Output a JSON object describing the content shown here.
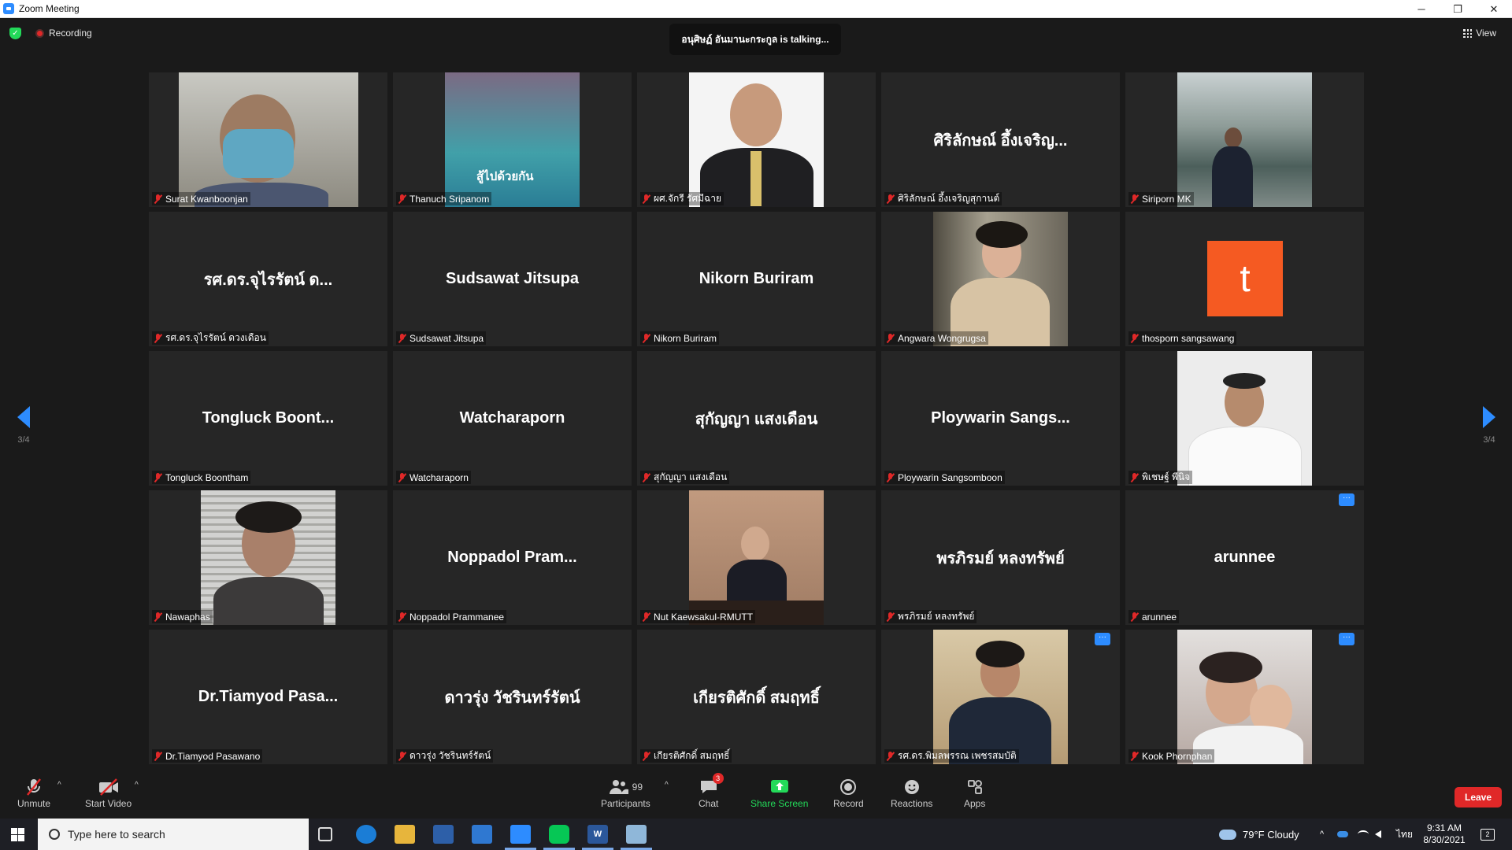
{
  "window": {
    "title": "Zoom Meeting"
  },
  "window_controls": {
    "minimize": "─",
    "maximize": "❐",
    "close": "✕"
  },
  "status": {
    "recording": "Recording",
    "talking": "อนุศิษฏ์ อันมานะกระกูล is talking...",
    "view": "View"
  },
  "pager": {
    "page": "3/4"
  },
  "participants": [
    {
      "label": "Surat Kwanboonjan",
      "type": "video"
    },
    {
      "label": "Thanuch Sripanom",
      "type": "video"
    },
    {
      "label": "ผศ.จักรี รัศมีฉาย",
      "type": "video"
    },
    {
      "label": "ศิริลักษณ์ อึ้งเจริญสุกานต์",
      "big": "ศิริลักษณ์ อึ้งเจริญ...",
      "type": "name"
    },
    {
      "label": "Siriporn MK",
      "type": "video"
    },
    {
      "label": "รศ.ดร.จุไรรัตน์ ดวงเดือน",
      "big": "รศ.ดร.จุไรรัตน์ ด...",
      "type": "name"
    },
    {
      "label": "Sudsawat Jitsupa",
      "big": "Sudsawat Jitsupa",
      "type": "name"
    },
    {
      "label": "Nikorn Buriram",
      "big": "Nikorn Buriram",
      "type": "name"
    },
    {
      "label": "Angwara Wongrugsa",
      "type": "video"
    },
    {
      "label": "thosporn sangsawang",
      "avatar": "t",
      "type": "avatar"
    },
    {
      "label": "Tongluck Boontham",
      "big": "Tongluck  Boont...",
      "type": "name"
    },
    {
      "label": "Watcharaporn",
      "big": "Watcharaporn",
      "type": "name"
    },
    {
      "label": "สุกัญญา  แสงเดือน",
      "big": "สุกัญญา แสงเดือน",
      "type": "name"
    },
    {
      "label": "Ploywarin Sangsomboon",
      "big": "Ploywarin  Sangs...",
      "type": "name"
    },
    {
      "label": "พิเชษฐ์ พีนิจ",
      "type": "video"
    },
    {
      "label": "Nawaphas",
      "type": "video"
    },
    {
      "label": "Noppadol Prammanee",
      "big": "Noppadol  Pram...",
      "type": "name"
    },
    {
      "label": "Nut Kaewsakul-RMUTT",
      "type": "video"
    },
    {
      "label": "พรภิรมย์  หลงทรัพย์",
      "big": "พรภิรมย์  หลงทรัพย์",
      "type": "name"
    },
    {
      "label": "arunnee",
      "big": "arunnee",
      "type": "name",
      "more": "···"
    },
    {
      "label": "Dr.Tiamyod Pasawano",
      "big": "Dr.Tiamyod  Pasa...",
      "type": "name"
    },
    {
      "label": "ดาวรุ่ง วัชรินทร์รัตน์",
      "big": "ดาวรุ่ง วัชรินทร์รัตน์",
      "type": "name"
    },
    {
      "label": "เกียรติศักดิ์ สมฤทธิ์",
      "big": "เกียรติศักดิ์ สมฤทธิ์",
      "type": "name"
    },
    {
      "label": "รศ.ดร.พิมลพรรณ เพชรสมบัติ",
      "type": "video",
      "more": "···"
    },
    {
      "label": "Kook Phornphan",
      "type": "video",
      "more": "···"
    }
  ],
  "toolbar": {
    "unmute": "Unmute",
    "start_video": "Start Video",
    "participants": "Participants",
    "participants_count": "99",
    "chat": "Chat",
    "chat_badge": "3",
    "share_screen": "Share Screen",
    "record": "Record",
    "reactions": "Reactions",
    "apps": "Apps",
    "leave": "Leave"
  },
  "taskbar": {
    "search_placeholder": "Type here to search",
    "weather": "79°F  Cloudy",
    "lang": "ไทย",
    "time": "9:31 AM",
    "date": "8/30/2021",
    "notifications": "2"
  },
  "colors": {
    "accent": "#2d8cff",
    "leave": "#e02828",
    "share": "#23d959",
    "avatar": "#f55a22"
  }
}
